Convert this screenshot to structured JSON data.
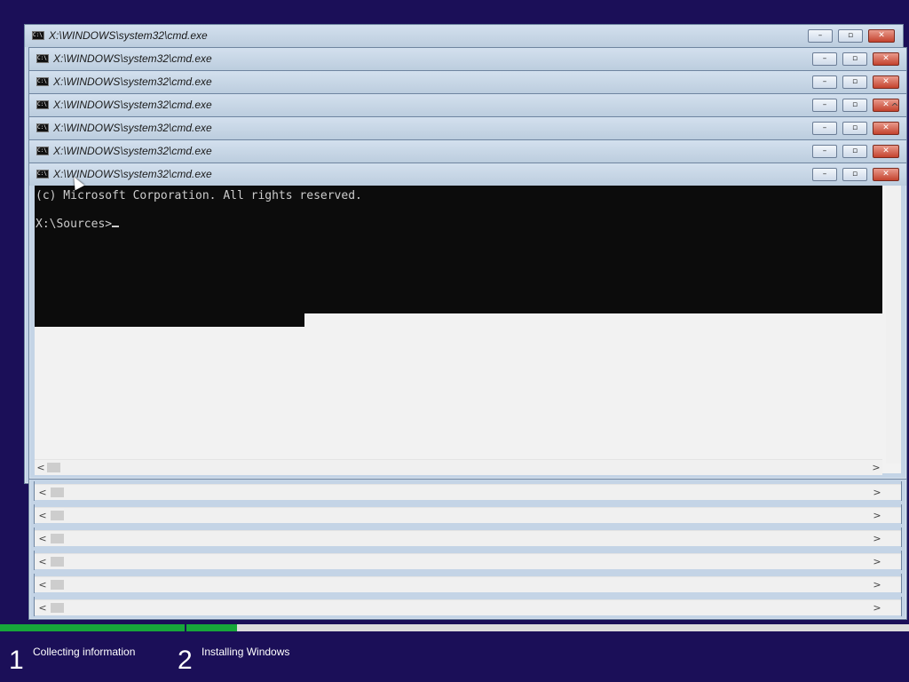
{
  "window_title": "X:\\WINDOWS\\system32\\cmd.exe",
  "icon_text": "C:\\",
  "controls": {
    "minimize": "–",
    "maximize": "▫",
    "close": "✕"
  },
  "terminal": {
    "line1": "(c) Microsoft Corporation. All rights reserved.",
    "line2": "X:\\Sources>"
  },
  "scrollbar": {
    "left_arrow": "<",
    "right_arrow": ">",
    "up_arrow": "^"
  },
  "setup": {
    "steps": [
      {
        "number": "1",
        "label": "Collecting information",
        "progress": 1.0
      },
      {
        "number": "2",
        "label": "Installing Windows",
        "progress": 0.07
      }
    ]
  },
  "colors": {
    "background": "#1b0f58",
    "progress_fill": "#17a63a",
    "terminal_bg": "#0c0c0c",
    "terminal_text": "#cccccc"
  }
}
